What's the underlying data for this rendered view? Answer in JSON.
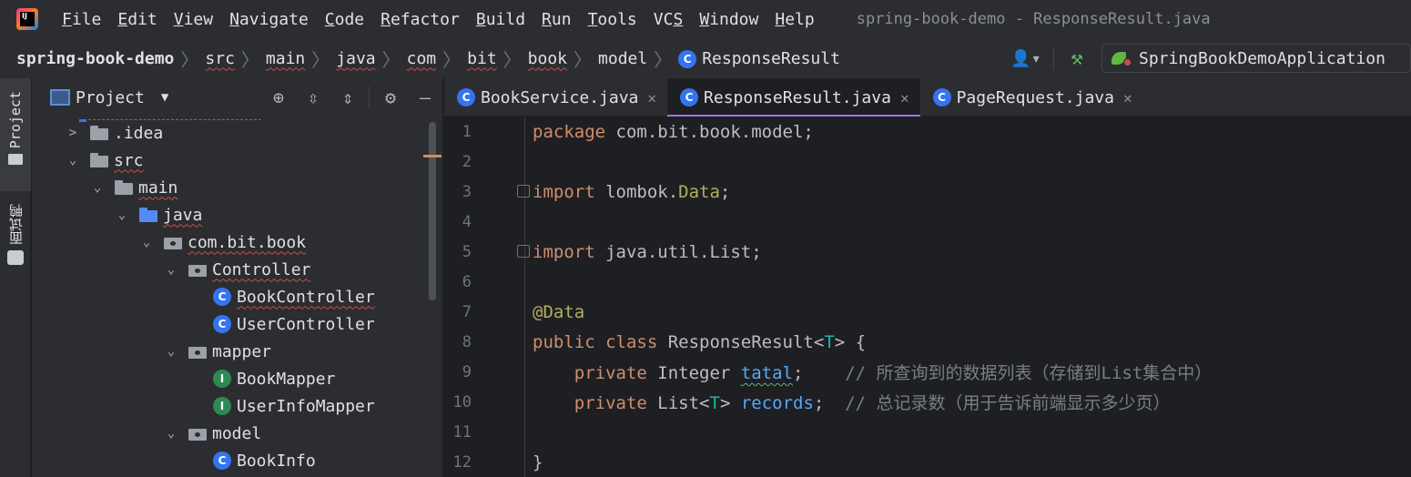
{
  "app": {
    "logo_text": "IJ"
  },
  "menu": [
    {
      "label": "File",
      "mnemonic": "F",
      "rest": "ile"
    },
    {
      "label": "Edit",
      "mnemonic": "E",
      "rest": "dit"
    },
    {
      "label": "View",
      "mnemonic": "V",
      "rest": "iew"
    },
    {
      "label": "Navigate",
      "mnemonic": "N",
      "rest": "avigate"
    },
    {
      "label": "Code",
      "mnemonic": "C",
      "rest": "ode"
    },
    {
      "label": "Refactor",
      "mnemonic": "R",
      "rest": "efactor"
    },
    {
      "label": "Build",
      "mnemonic": "B",
      "rest": "uild"
    },
    {
      "label": "Run",
      "mnemonic": "R",
      "rest": "un"
    },
    {
      "label": "Tools",
      "mnemonic": "T",
      "rest": "ools"
    },
    {
      "label": "VCS",
      "mnemonic": "S",
      "rest": "VC"
    },
    {
      "label": "Window",
      "mnemonic": "W",
      "rest": "indow"
    },
    {
      "label": "Help",
      "mnemonic": "H",
      "rest": "elp"
    }
  ],
  "window_title": "spring-book-demo - ResponseResult.java",
  "breadcrumb": [
    "spring-book-demo",
    "src",
    "main",
    "java",
    "com",
    "bit",
    "book",
    "model",
    "ResponseResult"
  ],
  "run_config": {
    "name": "SpringBookDemoApplication"
  },
  "toolstrip": {
    "project_label": "Project",
    "plugin_label": "面试鸭"
  },
  "project_panel": {
    "title": "Project",
    "tree": [
      {
        "label": ".idea",
        "arrow": "›",
        "icon": "folder-grey",
        "depth": 0
      },
      {
        "label": "src",
        "arrow": "⌄",
        "icon": "folder-grey",
        "depth": 0
      },
      {
        "label": "main",
        "arrow": "⌄",
        "icon": "folder-grey",
        "depth": 1
      },
      {
        "label": "java",
        "arrow": "⌄",
        "icon": "folder-blue",
        "depth": 2
      },
      {
        "label": "com.bit.book",
        "arrow": "⌄",
        "icon": "package",
        "depth": 3
      },
      {
        "label": "Controller",
        "arrow": "⌄",
        "icon": "package",
        "depth": 4
      },
      {
        "label": "BookController",
        "arrow": "",
        "icon": "class",
        "depth": 5
      },
      {
        "label": "UserController",
        "arrow": "",
        "icon": "class",
        "depth": 5
      },
      {
        "label": "mapper",
        "arrow": "⌄",
        "icon": "package",
        "depth": 4
      },
      {
        "label": "BookMapper",
        "arrow": "",
        "icon": "interface",
        "depth": 5
      },
      {
        "label": "UserInfoMapper",
        "arrow": "",
        "icon": "interface",
        "depth": 5
      },
      {
        "label": "model",
        "arrow": "⌄",
        "icon": "package",
        "depth": 4
      },
      {
        "label": "BookInfo",
        "arrow": "",
        "icon": "class",
        "depth": 5
      }
    ]
  },
  "tabs": [
    {
      "label": "BookService.java",
      "active": false
    },
    {
      "label": "ResponseResult.java",
      "active": true
    },
    {
      "label": "PageRequest.java",
      "active": false
    }
  ],
  "editor": {
    "lines": [
      {
        "n": "1",
        "parts": [
          [
            "kw",
            "package "
          ],
          [
            "plain",
            "com.bit.book.model;"
          ]
        ]
      },
      {
        "n": "2",
        "parts": []
      },
      {
        "n": "3",
        "fold": true,
        "parts": [
          [
            "kw",
            "import "
          ],
          [
            "plain",
            "lombok."
          ],
          [
            "typ",
            "Data"
          ],
          [
            "plain",
            ";"
          ]
        ]
      },
      {
        "n": "4",
        "parts": []
      },
      {
        "n": "5",
        "fold": true,
        "parts": [
          [
            "kw",
            "import "
          ],
          [
            "plain",
            "java.util.List;"
          ]
        ]
      },
      {
        "n": "6",
        "parts": []
      },
      {
        "n": "7",
        "parts": [
          [
            "ann",
            "@Data"
          ]
        ]
      },
      {
        "n": "8",
        "parts": [
          [
            "kw",
            "public class "
          ],
          [
            "plain",
            "ResponseResult<"
          ],
          [
            "gen",
            "T"
          ],
          [
            "plain",
            "> {"
          ]
        ]
      },
      {
        "n": "9",
        "parts": [
          [
            "plain",
            "    "
          ],
          [
            "kw",
            "private "
          ],
          [
            "plain",
            "Integer "
          ],
          [
            "fld2w",
            "tatal"
          ],
          [
            "plain",
            ";    "
          ],
          [
            "cmt",
            "// 所查询到的数据列表（存储到List集合中）"
          ]
        ]
      },
      {
        "n": "10",
        "parts": [
          [
            "plain",
            "    "
          ],
          [
            "kw",
            "private "
          ],
          [
            "plain",
            "List<"
          ],
          [
            "gen",
            "T"
          ],
          [
            "plain",
            "> "
          ],
          [
            "fld2",
            "records"
          ],
          [
            "plain",
            ";  "
          ],
          [
            "cmt",
            "// 总记录数（用于告诉前端显示多少页）"
          ]
        ]
      },
      {
        "n": "11",
        "parts": []
      },
      {
        "n": "12",
        "parts": [
          [
            "plain",
            "}"
          ]
        ]
      }
    ]
  }
}
